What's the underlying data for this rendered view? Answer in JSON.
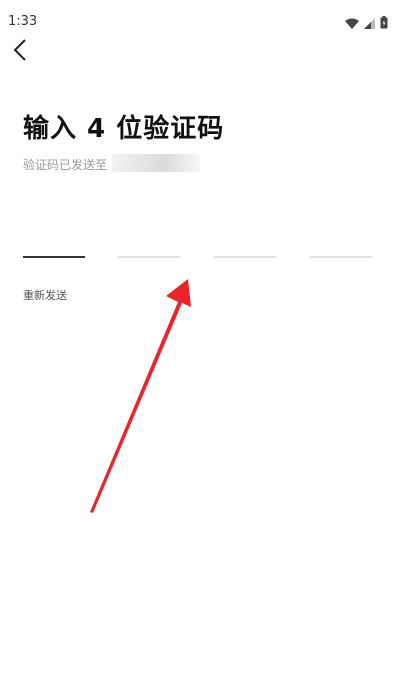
{
  "status": {
    "time": "1:33",
    "icons": [
      "wifi-icon",
      "signal-icon",
      "battery-icon"
    ]
  },
  "header": {
    "back_icon": "chevron-left-icon"
  },
  "main": {
    "title": "输入 4 位验证码",
    "subtitle": "验证码已发送至",
    "code_length": 4,
    "resend_label": "重新发送"
  },
  "annotation": {
    "arrow_color": "#e8252b"
  }
}
